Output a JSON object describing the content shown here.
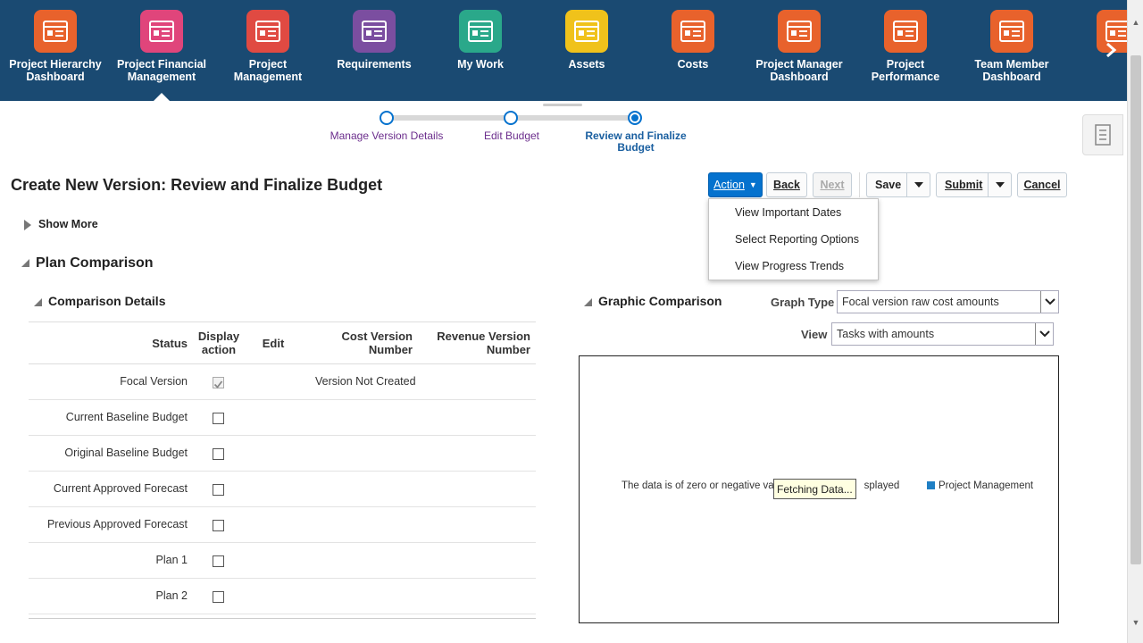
{
  "nav": {
    "items": [
      {
        "label": "Project Hierarchy Dashboard",
        "color": "#e8622c"
      },
      {
        "label": "Project Financial Management",
        "color": "#e0457b"
      },
      {
        "label": "Project Management",
        "color": "#e04a42"
      },
      {
        "label": "Requirements",
        "color": "#7b4ea0"
      },
      {
        "label": "My Work",
        "color": "#2aa88a"
      },
      {
        "label": "Assets",
        "color": "#f0c21b"
      },
      {
        "label": "Costs",
        "color": "#e8622c"
      },
      {
        "label": "Project Manager Dashboard",
        "color": "#e8622c"
      },
      {
        "label": "Project Performance",
        "color": "#e8622c"
      },
      {
        "label": "Team Member Dashboard",
        "color": "#e8622c"
      },
      {
        "label": "Pro",
        "color": "#e8622c"
      }
    ],
    "active_index": 1,
    "bg_color": "#1a4a72"
  },
  "train": {
    "stops": [
      {
        "label": "Manage Version Details",
        "state": "visited"
      },
      {
        "label": "Edit Budget",
        "state": "visited"
      },
      {
        "label": "Review and Finalize Budget",
        "state": "current"
      }
    ]
  },
  "page": {
    "title": "Create New Version: Review and Finalize Budget",
    "show_more": "Show More",
    "plan_comparison": "Plan Comparison",
    "comparison_details": "Comparison Details",
    "graphic_comparison": "Graphic Comparison"
  },
  "toolbar": {
    "action": "Action",
    "back": "Back",
    "next": "Next",
    "save": "Save",
    "submit": "Submit",
    "cancel": "Cancel"
  },
  "action_menu": {
    "items": [
      "View Important Dates",
      "Select Reporting Options",
      "View Progress Trends"
    ]
  },
  "table": {
    "headers": {
      "status": "Status",
      "display_action": "Display action",
      "edit": "Edit",
      "cost_version": "Cost Version Number",
      "revenue_version": "Revenue Version Number"
    },
    "rows": [
      {
        "status": "Focal Version",
        "checked": true,
        "cost_version": "Version Not Created"
      },
      {
        "status": "Current Baseline Budget",
        "checked": false,
        "cost_version": ""
      },
      {
        "status": "Original Baseline Budget",
        "checked": false,
        "cost_version": ""
      },
      {
        "status": "Current Approved Forecast",
        "checked": false,
        "cost_version": ""
      },
      {
        "status": "Previous Approved Forecast",
        "checked": false,
        "cost_version": ""
      },
      {
        "status": "Plan 1",
        "checked": false,
        "cost_version": ""
      },
      {
        "status": "Plan 2",
        "checked": false,
        "cost_version": ""
      }
    ]
  },
  "graph": {
    "graph_type_label": "Graph Type",
    "graph_type_value": "Focal version raw cost amounts",
    "view_label": "View",
    "view_value": "Tasks with amounts",
    "message": "The data is of zero or negative valu",
    "message_tail": "splayed",
    "legend_label": "Project Management",
    "legend_color": "#1f7fc4",
    "tooltip": "Fetching Data..."
  }
}
